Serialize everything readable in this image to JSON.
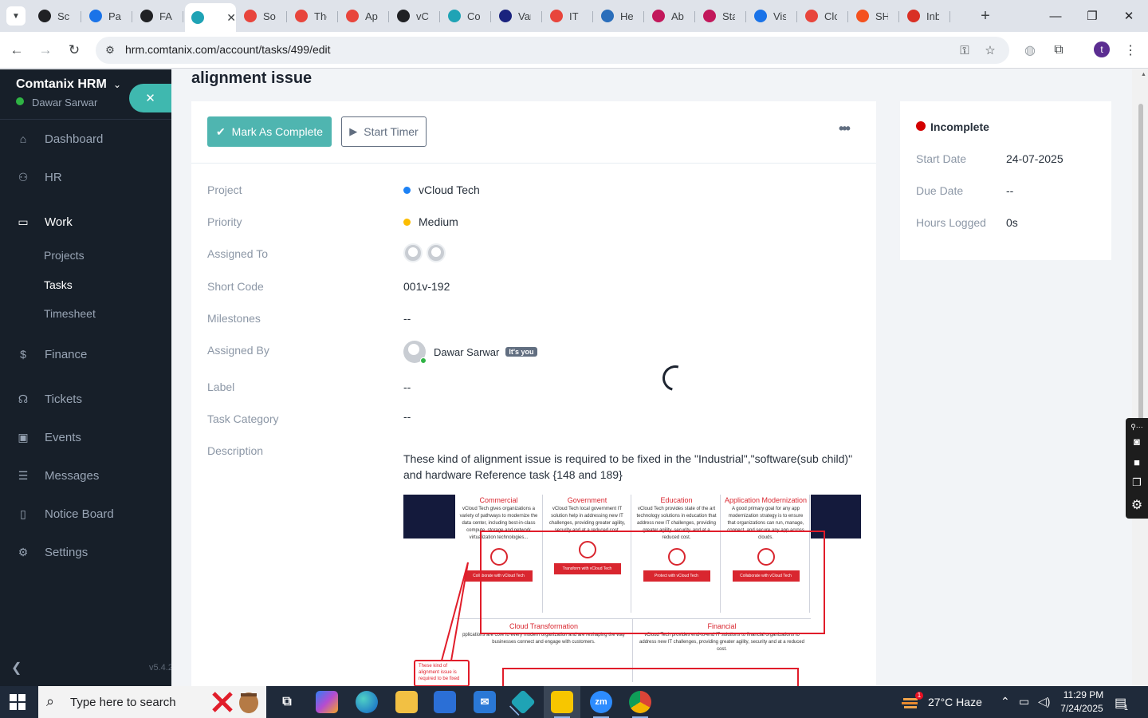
{
  "browser": {
    "tabs": [
      {
        "title": "Scr",
        "color": "#202124"
      },
      {
        "title": "Pag",
        "color": "#1a73e8"
      },
      {
        "title": "FAC",
        "color": "#202124"
      },
      {
        "title": "",
        "color": "#1fa3b5",
        "active": true
      },
      {
        "title": "Sof",
        "color": "#e8453c"
      },
      {
        "title": "The",
        "color": "#e8453c"
      },
      {
        "title": "App",
        "color": "#e8453c"
      },
      {
        "title": "vCl",
        "color": "#202124"
      },
      {
        "title": "Cor",
        "color": "#1fa3b5"
      },
      {
        "title": "Vari",
        "color": "#1a237e"
      },
      {
        "title": "IT I",
        "color": "#e8453c"
      },
      {
        "title": "Hei",
        "color": "#2a6ebb"
      },
      {
        "title": "Abc",
        "color": "#c2185b"
      },
      {
        "title": "Stat",
        "color": "#c2185b"
      },
      {
        "title": "Visi",
        "color": "#1a73e8"
      },
      {
        "title": "Clo",
        "color": "#e8453c"
      },
      {
        "title": "SHI",
        "color": "#f4511e"
      },
      {
        "title": "Inb",
        "color": "#d93025"
      }
    ],
    "url": "hrm.comtanix.com/account/tasks/499/edit",
    "profile_initial": "t"
  },
  "sidebar": {
    "brand": "Comtanix HRM",
    "user": "Dawar Sarwar",
    "nav": [
      {
        "label": "Dashboard",
        "icon": "home-icon"
      },
      {
        "label": "HR",
        "icon": "users-icon"
      },
      {
        "label": "Work",
        "icon": "briefcase-icon",
        "active": true
      },
      {
        "label": "Finance",
        "icon": "dollar-icon"
      },
      {
        "label": "Tickets",
        "icon": "headset-icon"
      },
      {
        "label": "Events",
        "icon": "calendar-icon"
      },
      {
        "label": "Messages",
        "icon": "message-icon"
      },
      {
        "label": "Notice Board",
        "icon": "clipboard-icon"
      },
      {
        "label": "Settings",
        "icon": "gear-icon"
      }
    ],
    "work_sub": [
      "Projects",
      "Tasks",
      "Timesheet"
    ],
    "version": "v5.4.2"
  },
  "task": {
    "title": "alignment issue",
    "mark_complete": "Mark As Complete",
    "start_timer": "Start Timer",
    "rows": {
      "project_label": "Project",
      "project_value": "vCloud Tech",
      "priority_label": "Priority",
      "priority_value": "Medium",
      "assigned_to_label": "Assigned To",
      "short_code_label": "Short Code",
      "short_code_value": "001v-192",
      "milestones_label": "Milestones",
      "milestones_value": "--",
      "assigned_by_label": "Assigned By",
      "assigned_by_value": "Dawar Sarwar",
      "its_you": "It's you",
      "label_label": "Label",
      "label_value": "--",
      "category_label": "Task Category",
      "category_value": "--",
      "description_label": "Description",
      "description_text": "These kind of alignment issue is required to be fixed in the \"Industrial\",\"software(sub child)\" and hardware Reference task {148 and 189}"
    },
    "colors": {
      "project_dot": "#1d82f5",
      "priority_dot": "#fcbd01"
    }
  },
  "desc_image": {
    "cols": [
      {
        "h": "Commercial",
        "t": "vCloud Tech gives organizations a variety of pathways to modernize the data center, including best-in-class compute, storage and network virtualization technologies...",
        "cta": "Collaborate with vCloud Tech"
      },
      {
        "h": "Government",
        "t": "vCloud Tech local government IT solution help in addressing new IT challenges, providing greater agility, security and at a reduced cost.",
        "cta": "Transform with vCloud Tech"
      },
      {
        "h": "Education",
        "t": "vCloud Tech provides state of the art technology solutions in education that address new IT challenges, providing greater agility, security, and at a reduced cost.",
        "cta": "Protect with vCloud Tech"
      },
      {
        "h": "Application Modernization",
        "t": "A good primary goal for any app modernization strategy is to ensure that organizations can run, manage, connect, and secure any app across clouds.",
        "cta": "Collaborate with vCloud Tech"
      }
    ],
    "row2": [
      {
        "h": "Cloud Transformation",
        "t": "pplications are core to every modern organization and are reshaping the way businesses connect and engage with customers."
      },
      {
        "h": "Financial",
        "t": "vCloud Tech provides end-to-end IT solutions to financial organizations to address new IT challenges, providing greater agility, security and at a reduced cost."
      }
    ],
    "annotation": "These kind of alignment issue is required to be fixed"
  },
  "info": {
    "status": "Incomplete",
    "start_label": "Start Date",
    "start_value": "24-07-2025",
    "due_label": "Due Date",
    "due_value": "--",
    "hours_label": "Hours Logged",
    "hours_value": "0s"
  },
  "taskbar": {
    "search_placeholder": "Type here to search",
    "weather": "27°C  Haze",
    "weather_badge": "1",
    "time": "11:29 PM",
    "date": "7/24/2025",
    "notif_count": "1"
  }
}
